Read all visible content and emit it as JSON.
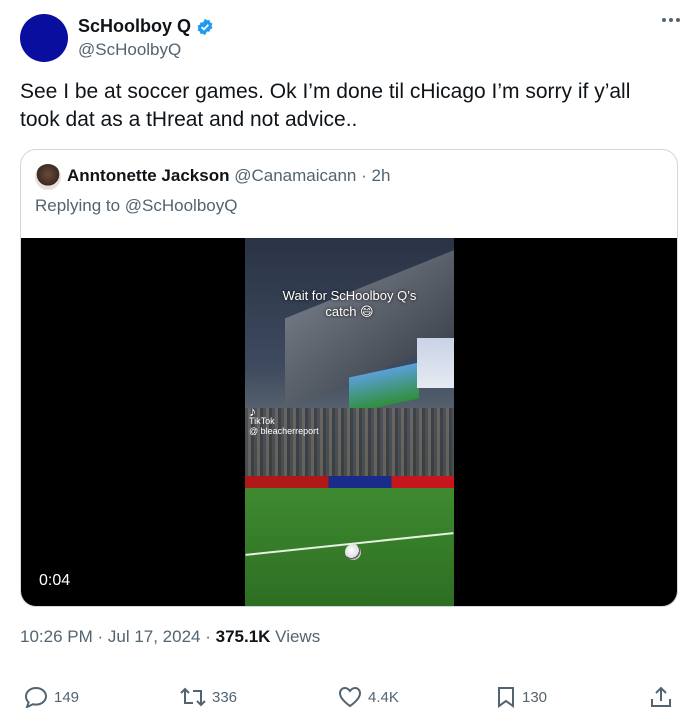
{
  "author": {
    "name": "ScHoolboy Q",
    "handle": "@ScHoolbyQ",
    "verified": true,
    "avatar_color": "#0a0e9e"
  },
  "tweet": {
    "text": "See I be at soccer games. Ok I’m done til cHicago I’m sorry if y’all took dat as a tHreat and not advice.."
  },
  "quote": {
    "name": "Anntonette Jackson",
    "handle": "@Canamaicann",
    "sep": "·",
    "time": "2h",
    "replying": "Replying to @ScHoolboyQ",
    "video": {
      "caption_line1": "Wait for ScHoolboy Q’s",
      "caption_line2": "catch 😄",
      "watermark": "TikTok",
      "watermark_user": "@ bleacherreport",
      "timestamp": "0:04"
    }
  },
  "meta": {
    "time_date": "10:26 PM · Jul 17, 2024 · ",
    "views_count": "375.1K",
    "views_label": " Views"
  },
  "actions": {
    "replies": "149",
    "reposts": "336",
    "likes": "4.4K",
    "bookmarks": "130"
  },
  "colors": {
    "verified": "#1d9bf0",
    "secondary_text": "#536471"
  }
}
